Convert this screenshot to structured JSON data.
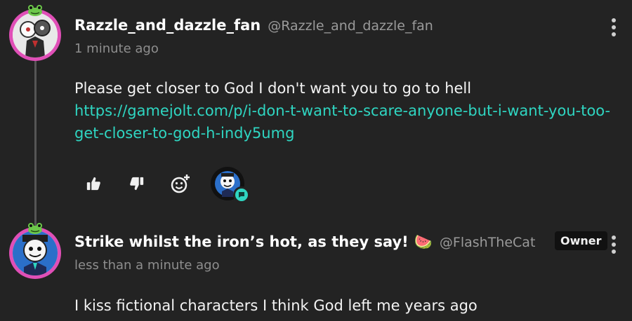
{
  "comments": [
    {
      "author_name": "Razzle_and_dazzle_fan",
      "author_handle": "@Razzle_and_dazzle_fan",
      "timestamp": "1 minute ago",
      "text": "Please get closer to God I don't want you to go to hell",
      "link_line1": "https://gamejolt.com/p/i-don-t-want-to-scare-anyone-but-i-want-you-too-",
      "link_line2": "get-closer-to-god-h-indy5umg"
    },
    {
      "author_name": "Strike whilst the iron’s hot, as they say!",
      "author_emoji": "🍉",
      "author_handle": "@FlashTheCat",
      "badge": "Owner",
      "timestamp": "less than a minute ago",
      "text": "I kiss fictional characters I think God left me years ago"
    }
  ],
  "icons": {
    "like": "thumbs-up-icon",
    "dislike": "thumbs-down-icon",
    "react": "add-reaction-icon",
    "more": "more-vertical-icon"
  },
  "colors": {
    "background": "#232323",
    "link": "#2fd6c2",
    "avatar_ring": "#e04fb7"
  }
}
